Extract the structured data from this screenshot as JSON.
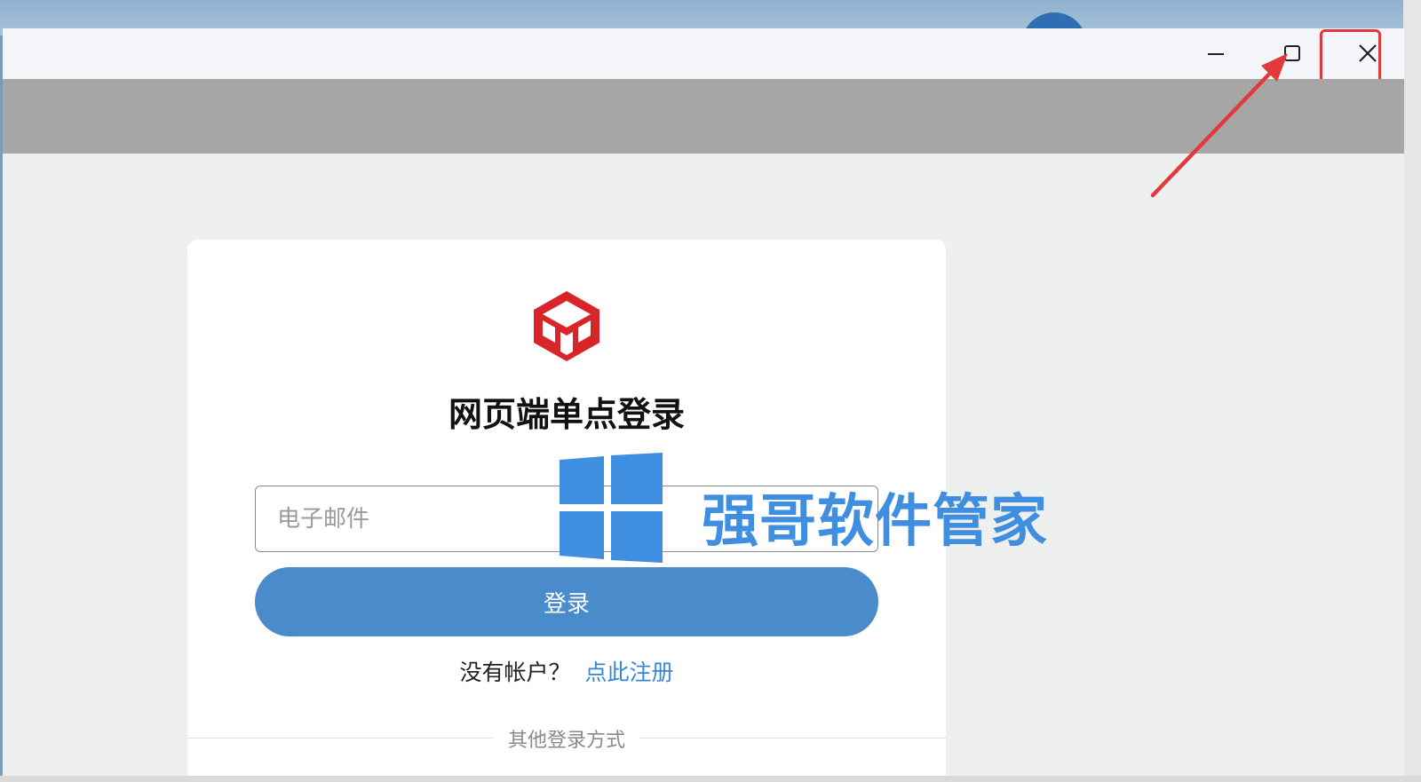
{
  "window": {
    "minimize_label": "最小化",
    "maximize_label": "最大化",
    "close_label": "关闭"
  },
  "login": {
    "title": "网页端单点登录",
    "email_placeholder": "电子邮件",
    "email_value": "",
    "login_button": "登录",
    "no_account_text": "没有帐户？",
    "signup_link": "点此注册",
    "other_methods": "其他登录方式"
  },
  "watermark": {
    "text": "强哥软件管家",
    "logo_icon": "windows-logo-icon"
  },
  "colors": {
    "accent": "#4a8bcb",
    "link": "#3a86d6",
    "annotation": "#e23a3a",
    "logo_red": "#d8252a",
    "watermark": "#3f8ee0"
  },
  "icons": {
    "app_logo": "cube-m-logo-icon",
    "minimize": "minimize-icon",
    "maximize": "maximize-icon",
    "close": "close-icon",
    "annotation_arrow": "arrow-icon"
  }
}
